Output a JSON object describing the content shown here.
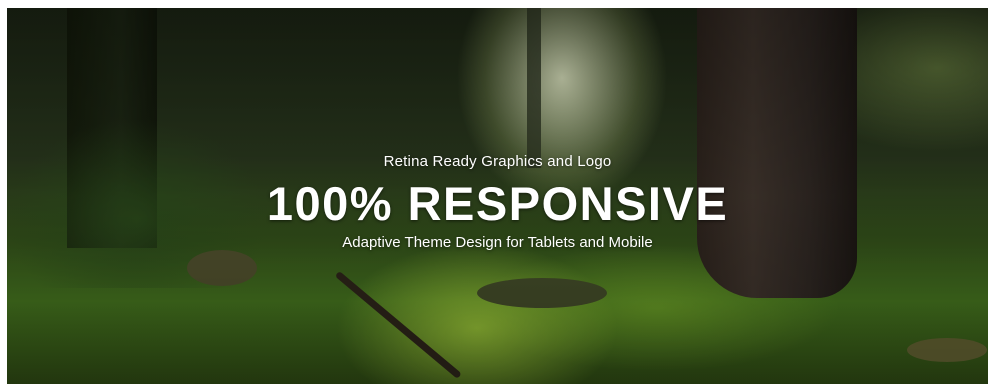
{
  "hero": {
    "kicker": "Retina Ready Graphics and Logo",
    "headline": "100% RESPONSIVE",
    "subline": "Adaptive Theme Design for Tablets and Mobile"
  }
}
